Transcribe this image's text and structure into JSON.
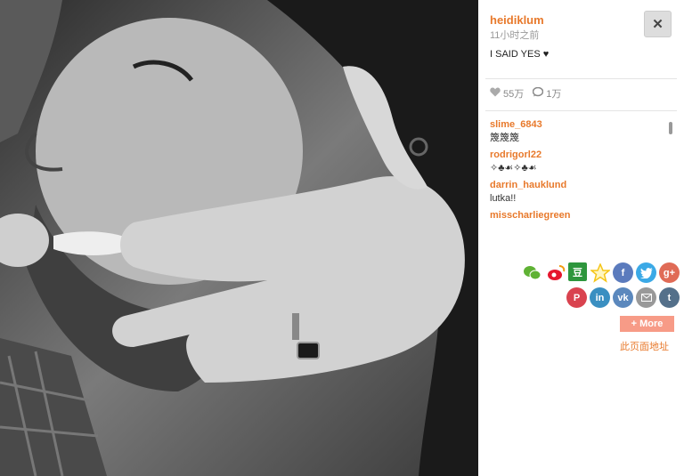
{
  "post": {
    "username": "heidiklum",
    "time": "11小时之前",
    "caption": "I SAID YES ♥",
    "likes": "55万",
    "comments_count": "1万"
  },
  "comments": [
    {
      "user": "slime_6843",
      "text": "篾篾篾"
    },
    {
      "user": "rodrigorl22",
      "text": "✧♣☙✧♣☙"
    },
    {
      "user": "darrin_hauklund",
      "text": "lutka!!"
    },
    {
      "user": "misscharliegreen",
      "text": ""
    }
  ],
  "share": {
    "row1": [
      "wechat-icon",
      "weibo-icon",
      "douban-icon",
      "star-icon",
      "facebook-icon",
      "twitter-icon",
      "googleplus-icon"
    ],
    "row2": [
      "pinterest-icon",
      "linkedin-icon",
      "vk-icon",
      "email-icon",
      "tumblr-icon"
    ],
    "colors": {
      "wechat": "#5fb234",
      "weibo": "#e6162d",
      "douban": "#2e963d",
      "star": "#f5c518",
      "facebook": "#5b7bbd",
      "twitter": "#3ba9e6",
      "googleplus": "#e06b56",
      "pinterest": "#d9434f",
      "linkedin": "#3a8fc1",
      "vk": "#5b88bd",
      "email": "#999999",
      "tumblr": "#54708a"
    },
    "more_label": "+ More",
    "page_link": "此页面地址"
  },
  "accent": "#e8792b"
}
